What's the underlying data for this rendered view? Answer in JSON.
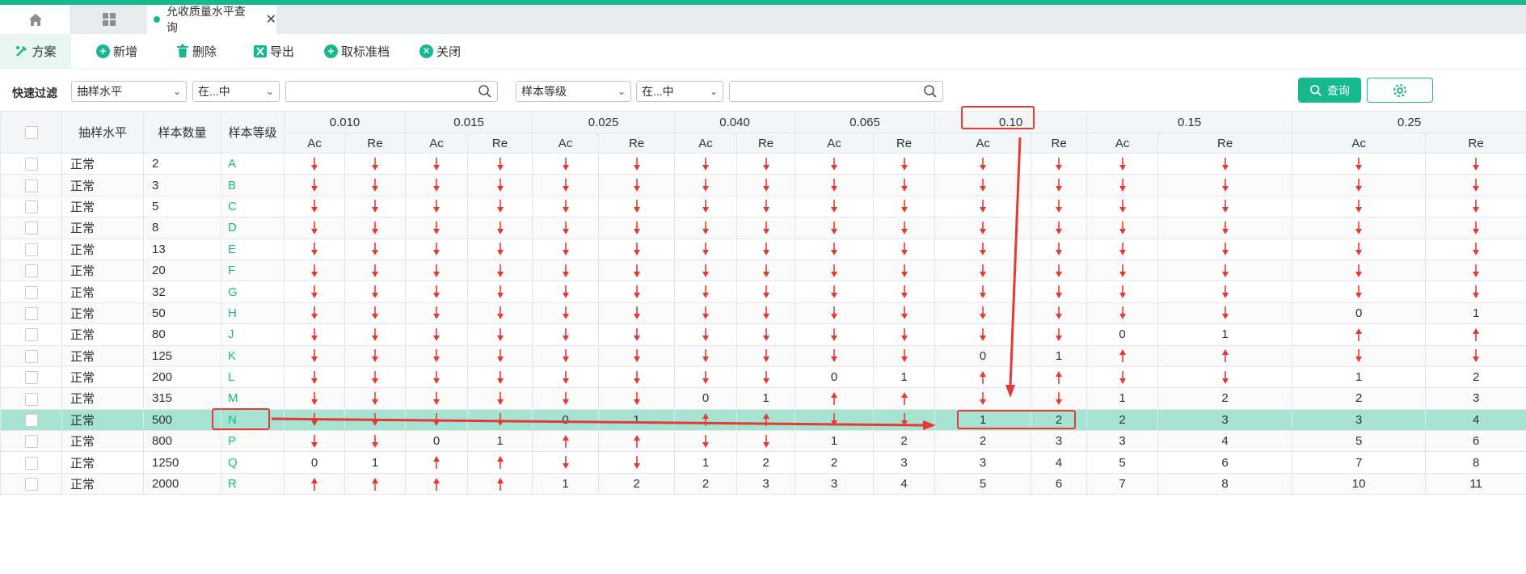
{
  "tabs": {
    "active_label": "允收质量水平查询",
    "home_icon": "home-icon",
    "grid_icon": "grid-icon",
    "close_symbol": "✕"
  },
  "toolbar": {
    "scheme": "方案",
    "add": "新增",
    "delete": "删除",
    "export": "导出",
    "unset_standard": "取标准档",
    "close": "关闭"
  },
  "filter": {
    "label": "快速过滤",
    "field1": "抽样水平",
    "op1": "在...中",
    "value1": "",
    "field2": "样本等级",
    "op2": "在...中",
    "value2": "",
    "query": "查询",
    "settings_icon": "gear-icon"
  },
  "colors": {
    "accent": "#16b88e",
    "highlight_row": "#a6e3d2",
    "arrow": "#e53935"
  },
  "table": {
    "headers": {
      "level": "抽样水平",
      "count": "样本数量",
      "grade": "样本等级"
    },
    "aql": [
      "0.010",
      "0.015",
      "0.025",
      "0.040",
      "0.065",
      "0.10",
      "0.15",
      "0.25"
    ],
    "sub": {
      "ac": "Ac",
      "re": "Re"
    },
    "rows": [
      {
        "level": "正常",
        "count": "2",
        "grade": "A",
        "cells": [
          "d",
          "d",
          "d",
          "d",
          "d",
          "d",
          "d",
          "d",
          "d",
          "d",
          "d",
          "d",
          "d",
          "d",
          "d",
          "d"
        ]
      },
      {
        "level": "正常",
        "count": "3",
        "grade": "B",
        "cells": [
          "d",
          "d",
          "d",
          "d",
          "d",
          "d",
          "d",
          "d",
          "d",
          "d",
          "d",
          "d",
          "d",
          "d",
          "d",
          "d"
        ]
      },
      {
        "level": "正常",
        "count": "5",
        "grade": "C",
        "cells": [
          "d",
          "d",
          "d",
          "d",
          "d",
          "d",
          "d",
          "d",
          "d",
          "d",
          "d",
          "d",
          "d",
          "d",
          "d",
          "d"
        ]
      },
      {
        "level": "正常",
        "count": "8",
        "grade": "D",
        "cells": [
          "d",
          "d",
          "d",
          "d",
          "d",
          "d",
          "d",
          "d",
          "d",
          "d",
          "d",
          "d",
          "d",
          "d",
          "d",
          "d"
        ]
      },
      {
        "level": "正常",
        "count": "13",
        "grade": "E",
        "cells": [
          "d",
          "d",
          "d",
          "d",
          "d",
          "d",
          "d",
          "d",
          "d",
          "d",
          "d",
          "d",
          "d",
          "d",
          "d",
          "d"
        ]
      },
      {
        "level": "正常",
        "count": "20",
        "grade": "F",
        "cells": [
          "d",
          "d",
          "d",
          "d",
          "d",
          "d",
          "d",
          "d",
          "d",
          "d",
          "d",
          "d",
          "d",
          "d",
          "d",
          "d"
        ]
      },
      {
        "level": "正常",
        "count": "32",
        "grade": "G",
        "cells": [
          "d",
          "d",
          "d",
          "d",
          "d",
          "d",
          "d",
          "d",
          "d",
          "d",
          "d",
          "d",
          "d",
          "d",
          "d",
          "d"
        ]
      },
      {
        "level": "正常",
        "count": "50",
        "grade": "H",
        "cells": [
          "d",
          "d",
          "d",
          "d",
          "d",
          "d",
          "d",
          "d",
          "d",
          "d",
          "d",
          "d",
          "d",
          "d",
          "0",
          "1"
        ]
      },
      {
        "level": "正常",
        "count": "80",
        "grade": "J",
        "cells": [
          "d",
          "d",
          "d",
          "d",
          "d",
          "d",
          "d",
          "d",
          "d",
          "d",
          "d",
          "d",
          "0",
          "1",
          "u",
          "u"
        ]
      },
      {
        "level": "正常",
        "count": "125",
        "grade": "K",
        "cells": [
          "d",
          "d",
          "d",
          "d",
          "d",
          "d",
          "d",
          "d",
          "d",
          "d",
          "0",
          "1",
          "u",
          "u",
          "d",
          "d"
        ]
      },
      {
        "level": "正常",
        "count": "200",
        "grade": "L",
        "cells": [
          "d",
          "d",
          "d",
          "d",
          "d",
          "d",
          "d",
          "d",
          "0",
          "1",
          "u",
          "u",
          "d",
          "d",
          "1",
          "2"
        ]
      },
      {
        "level": "正常",
        "count": "315",
        "grade": "M",
        "cells": [
          "d",
          "d",
          "d",
          "d",
          "d",
          "d",
          "0",
          "1",
          "u",
          "u",
          "d",
          "d",
          "1",
          "2",
          "2",
          "3"
        ]
      },
      {
        "level": "正常",
        "count": "500",
        "grade": "N",
        "cells": [
          "d",
          "d",
          "d",
          "d",
          "0",
          "1",
          "u",
          "u",
          "d",
          "d",
          "1",
          "2",
          "2",
          "3",
          "3",
          "4"
        ]
      },
      {
        "level": "正常",
        "count": "800",
        "grade": "P",
        "cells": [
          "d",
          "d",
          "0",
          "1",
          "u",
          "u",
          "d",
          "d",
          "1",
          "2",
          "2",
          "3",
          "3",
          "4",
          "5",
          "6"
        ]
      },
      {
        "level": "正常",
        "count": "1250",
        "grade": "Q",
        "cells": [
          "0",
          "1",
          "u",
          "u",
          "d",
          "d",
          "1",
          "2",
          "2",
          "3",
          "3",
          "4",
          "5",
          "6",
          "7",
          "8"
        ]
      },
      {
        "level": "正常",
        "count": "2000",
        "grade": "R",
        "cells": [
          "u",
          "u",
          "u",
          "u",
          "1",
          "2",
          "2",
          "3",
          "3",
          "4",
          "5",
          "6",
          "7",
          "8",
          "10",
          "11"
        ]
      }
    ],
    "selected_row": 12
  }
}
